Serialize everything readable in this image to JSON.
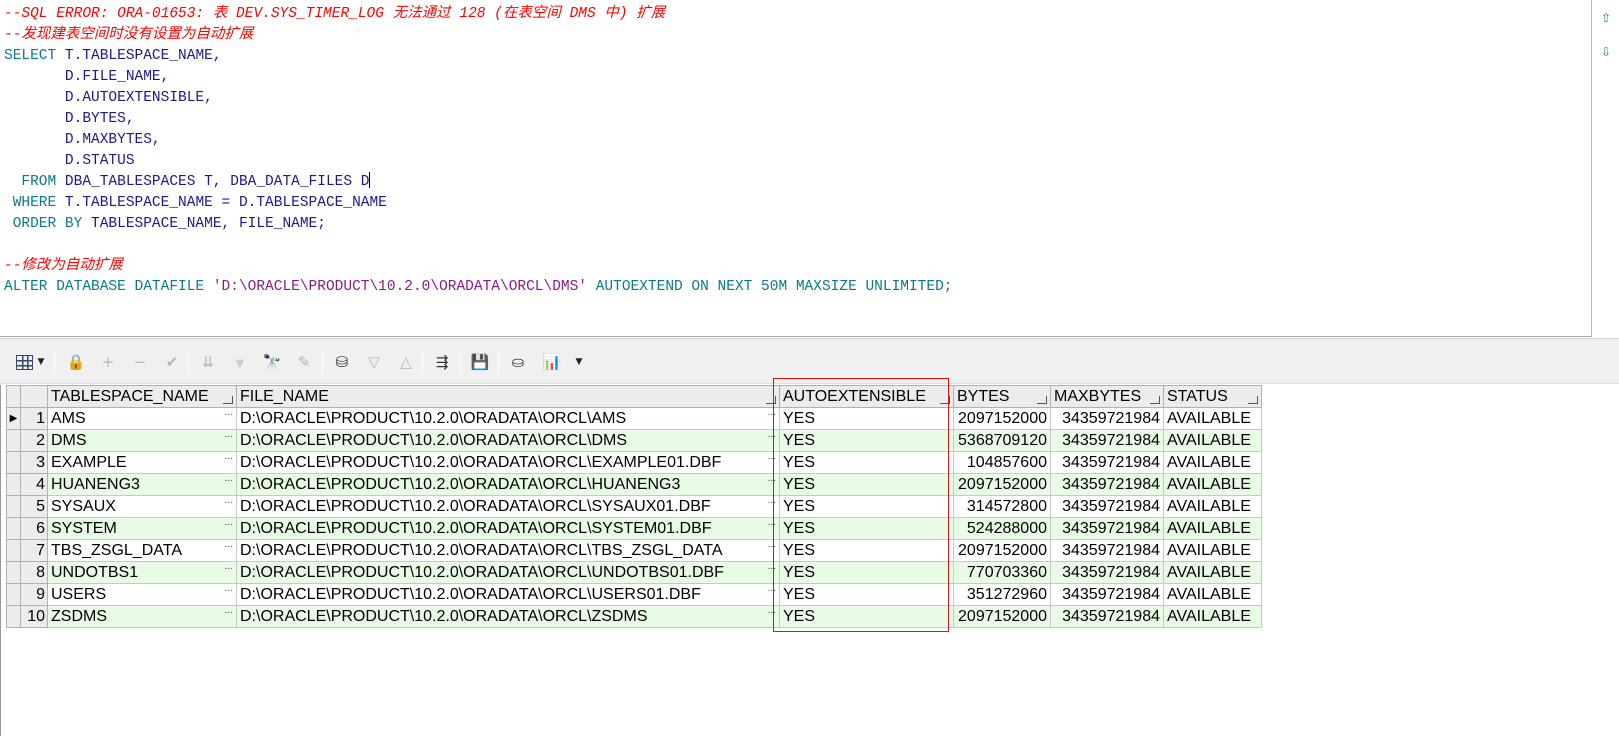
{
  "editor": {
    "lines": [
      [
        {
          "t": "--SQL ERROR: ORA-01653: 表 DEV.SYS_TIMER_LOG 无法通过 128 (在表空间 DMS 中) 扩展",
          "c": "cm"
        }
      ],
      [
        {
          "t": "--发现建表空间时没有设置为自动扩展",
          "c": "cm"
        }
      ],
      [
        {
          "t": "SELECT ",
          "c": "kw"
        },
        {
          "t": "T.TABLESPACE_NAME,",
          "c": "id"
        }
      ],
      [
        {
          "t": "       D.FILE_NAME,",
          "c": "id"
        }
      ],
      [
        {
          "t": "       D.AUTOEXTENSIBLE,",
          "c": "id"
        }
      ],
      [
        {
          "t": "       D.BYTES,",
          "c": "id"
        }
      ],
      [
        {
          "t": "       D.MAXBYTES,",
          "c": "id"
        }
      ],
      [
        {
          "t": "       D.STATUS",
          "c": "id"
        }
      ],
      [
        {
          "t": "  FROM ",
          "c": "kw"
        },
        {
          "t": "DBA_TABLESPACES T, DBA_DATA_FILES D",
          "c": "id"
        },
        {
          "t": "",
          "c": "caret"
        }
      ],
      [
        {
          "t": " WHERE ",
          "c": "kw"
        },
        {
          "t": "T.TABLESPACE_NAME = D.TABLESPACE_NAME",
          "c": "id"
        }
      ],
      [
        {
          "t": " ORDER BY ",
          "c": "kw"
        },
        {
          "t": "TABLESPACE_NAME, FILE_NAME;",
          "c": "id"
        }
      ],
      [
        {
          "t": "",
          "c": "id"
        }
      ],
      [
        {
          "t": "--修改为自动扩展",
          "c": "cm"
        }
      ],
      [
        {
          "t": "ALTER DATABASE DATAFILE ",
          "c": "kw"
        },
        {
          "t": "'D:\\ORACLE\\PRODUCT\\10.2.0\\ORADATA\\ORCL\\DMS'",
          "c": "st"
        },
        {
          "t": " AUTOEXTEND ON NEXT ",
          "c": "kw"
        },
        {
          "t": "50M",
          "c": "nm"
        },
        {
          "t": " MAXSIZE UNLIMITED;",
          "c": "kw"
        }
      ]
    ]
  },
  "toolbar": {
    "buttons": [
      {
        "name": "grid-view-icon",
        "disabled": false,
        "glyph": ""
      },
      {
        "name": "lock-icon",
        "disabled": false,
        "glyph": "🔒"
      },
      {
        "name": "add-record-icon",
        "disabled": true,
        "glyph": "+"
      },
      {
        "name": "delete-record-icon",
        "disabled": true,
        "glyph": "−"
      },
      {
        "name": "post-changes-icon",
        "disabled": true,
        "glyph": "✔"
      },
      {
        "name": "fetch-next-icon",
        "disabled": true,
        "glyph": "⇊"
      },
      {
        "name": "fetch-last-icon",
        "disabled": true,
        "glyph": "⩔"
      },
      {
        "name": "find-icon",
        "disabled": false,
        "glyph": "🔭"
      },
      {
        "name": "clear-icon",
        "disabled": true,
        "glyph": "✎"
      },
      {
        "name": "query-by-example-icon",
        "disabled": false,
        "glyph": "⛁"
      },
      {
        "name": "next-record-icon",
        "disabled": true,
        "glyph": "▽"
      },
      {
        "name": "previous-record-icon",
        "disabled": true,
        "glyph": "△"
      },
      {
        "name": "link-icon",
        "disabled": false,
        "glyph": "⇶"
      },
      {
        "name": "save-icon",
        "disabled": false,
        "glyph": "💾"
      },
      {
        "name": "export-icon",
        "disabled": false,
        "glyph": "⛀"
      },
      {
        "name": "chart-icon",
        "disabled": false,
        "glyph": "📊"
      }
    ]
  },
  "grid": {
    "columns": [
      "TABLESPACE_NAME",
      "FILE_NAME",
      "AUTOEXTENSIBLE",
      "BYTES",
      "MAXBYTES",
      "STATUS"
    ],
    "rows": [
      [
        "1",
        "AMS",
        "D:\\ORACLE\\PRODUCT\\10.2.0\\ORADATA\\ORCL\\AMS",
        "YES",
        "2097152000",
        "34359721984",
        "AVAILABLE"
      ],
      [
        "2",
        "DMS",
        "D:\\ORACLE\\PRODUCT\\10.2.0\\ORADATA\\ORCL\\DMS",
        "YES",
        "5368709120",
        "34359721984",
        "AVAILABLE"
      ],
      [
        "3",
        "EXAMPLE",
        "D:\\ORACLE\\PRODUCT\\10.2.0\\ORADATA\\ORCL\\EXAMPLE01.DBF",
        "YES",
        "104857600",
        "34359721984",
        "AVAILABLE"
      ],
      [
        "4",
        "HUANENG3",
        "D:\\ORACLE\\PRODUCT\\10.2.0\\ORADATA\\ORCL\\HUANENG3",
        "YES",
        "2097152000",
        "34359721984",
        "AVAILABLE"
      ],
      [
        "5",
        "SYSAUX",
        "D:\\ORACLE\\PRODUCT\\10.2.0\\ORADATA\\ORCL\\SYSAUX01.DBF",
        "YES",
        "314572800",
        "34359721984",
        "AVAILABLE"
      ],
      [
        "6",
        "SYSTEM",
        "D:\\ORACLE\\PRODUCT\\10.2.0\\ORADATA\\ORCL\\SYSTEM01.DBF",
        "YES",
        "524288000",
        "34359721984",
        "AVAILABLE"
      ],
      [
        "7",
        "TBS_ZSGL_DATA",
        "D:\\ORACLE\\PRODUCT\\10.2.0\\ORADATA\\ORCL\\TBS_ZSGL_DATA",
        "YES",
        "2097152000",
        "34359721984",
        "AVAILABLE"
      ],
      [
        "8",
        "UNDOTBS1",
        "D:\\ORACLE\\PRODUCT\\10.2.0\\ORADATA\\ORCL\\UNDOTBS01.DBF",
        "YES",
        "770703360",
        "34359721984",
        "AVAILABLE"
      ],
      [
        "9",
        "USERS",
        "D:\\ORACLE\\PRODUCT\\10.2.0\\ORADATA\\ORCL\\USERS01.DBF",
        "YES",
        "351272960",
        "34359721984",
        "AVAILABLE"
      ],
      [
        "10",
        "ZSDMS",
        "D:\\ORACLE\\PRODUCT\\10.2.0\\ORADATA\\ORCL\\ZSDMS",
        "YES",
        "2097152000",
        "34359721984",
        "AVAILABLE"
      ]
    ],
    "current_row_marker": "▶",
    "ellipsis": "...",
    "highlight_color": "#e01010",
    "alt_row_color": "#e8fbe5"
  }
}
